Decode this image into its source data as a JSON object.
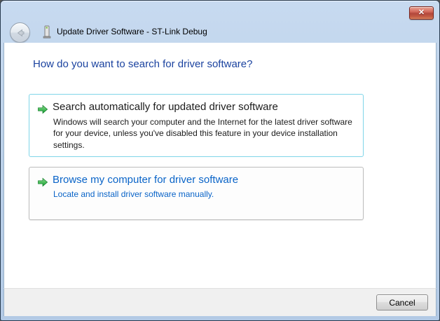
{
  "window": {
    "title": "Update Driver Software - ST-Link Debug"
  },
  "header": {
    "question": "How do you want to search for driver software?"
  },
  "options": [
    {
      "title": "Search automatically for updated driver software",
      "description": "Windows will search your computer and the Internet for the latest driver software for your device, unless you've disabled this feature in your device installation settings.",
      "state": "highlighted"
    },
    {
      "title": "Browse my computer for driver software",
      "description": "Locate and install driver software manually.",
      "state": "normal"
    }
  ],
  "footer": {
    "cancel_label": "Cancel"
  },
  "icons": {
    "close": "close-icon",
    "back": "arrow-left-icon",
    "device": "device-icon",
    "option_marker": "green-arrow-right-icon"
  },
  "colors": {
    "frame_blue": "#b9d1e8",
    "heading_text": "#1a429f",
    "link_text": "#0a64c8",
    "option_highlight_border": "#7fd5e8",
    "option_border": "#bdbdbd",
    "arrow_green": "#27a838",
    "close_button_red": "#c5453a",
    "footer_background": "#f0f0f0",
    "cancel_text": "#000000"
  }
}
